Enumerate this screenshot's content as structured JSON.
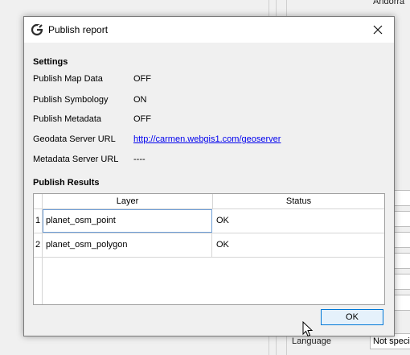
{
  "background_app": {
    "top_right_text": "Andorra",
    "language_label": "Language",
    "language_value": "Not specif"
  },
  "dialog": {
    "title": "Publish report",
    "settings_heading": "Settings",
    "settings": [
      {
        "label": "Publish Map Data",
        "value": "OFF"
      },
      {
        "label": "Publish Symbology",
        "value": "ON"
      },
      {
        "label": "Publish Metadata",
        "value": "OFF"
      },
      {
        "label": "Geodata Server URL",
        "value": "http://carmen.webgis1.com/geoserver"
      },
      {
        "label": "Metadata Server URL",
        "value": "----"
      }
    ],
    "results_heading": "Publish Results",
    "results_table": {
      "columns": [
        "Layer",
        "Status"
      ],
      "rows": [
        {
          "n": "1",
          "layer": "planet_osm_point",
          "status": "OK"
        },
        {
          "n": "2",
          "layer": "planet_osm_polygon",
          "status": "OK"
        }
      ]
    },
    "ok_label": "OK"
  },
  "colors": {
    "accent": "#0078d7",
    "link": "#0000ee",
    "app_icon": "#2d2d2d"
  },
  "icons": {
    "app": "app-logo-icon",
    "close": "close-icon",
    "cursor": "mouse-pointer-icon"
  }
}
